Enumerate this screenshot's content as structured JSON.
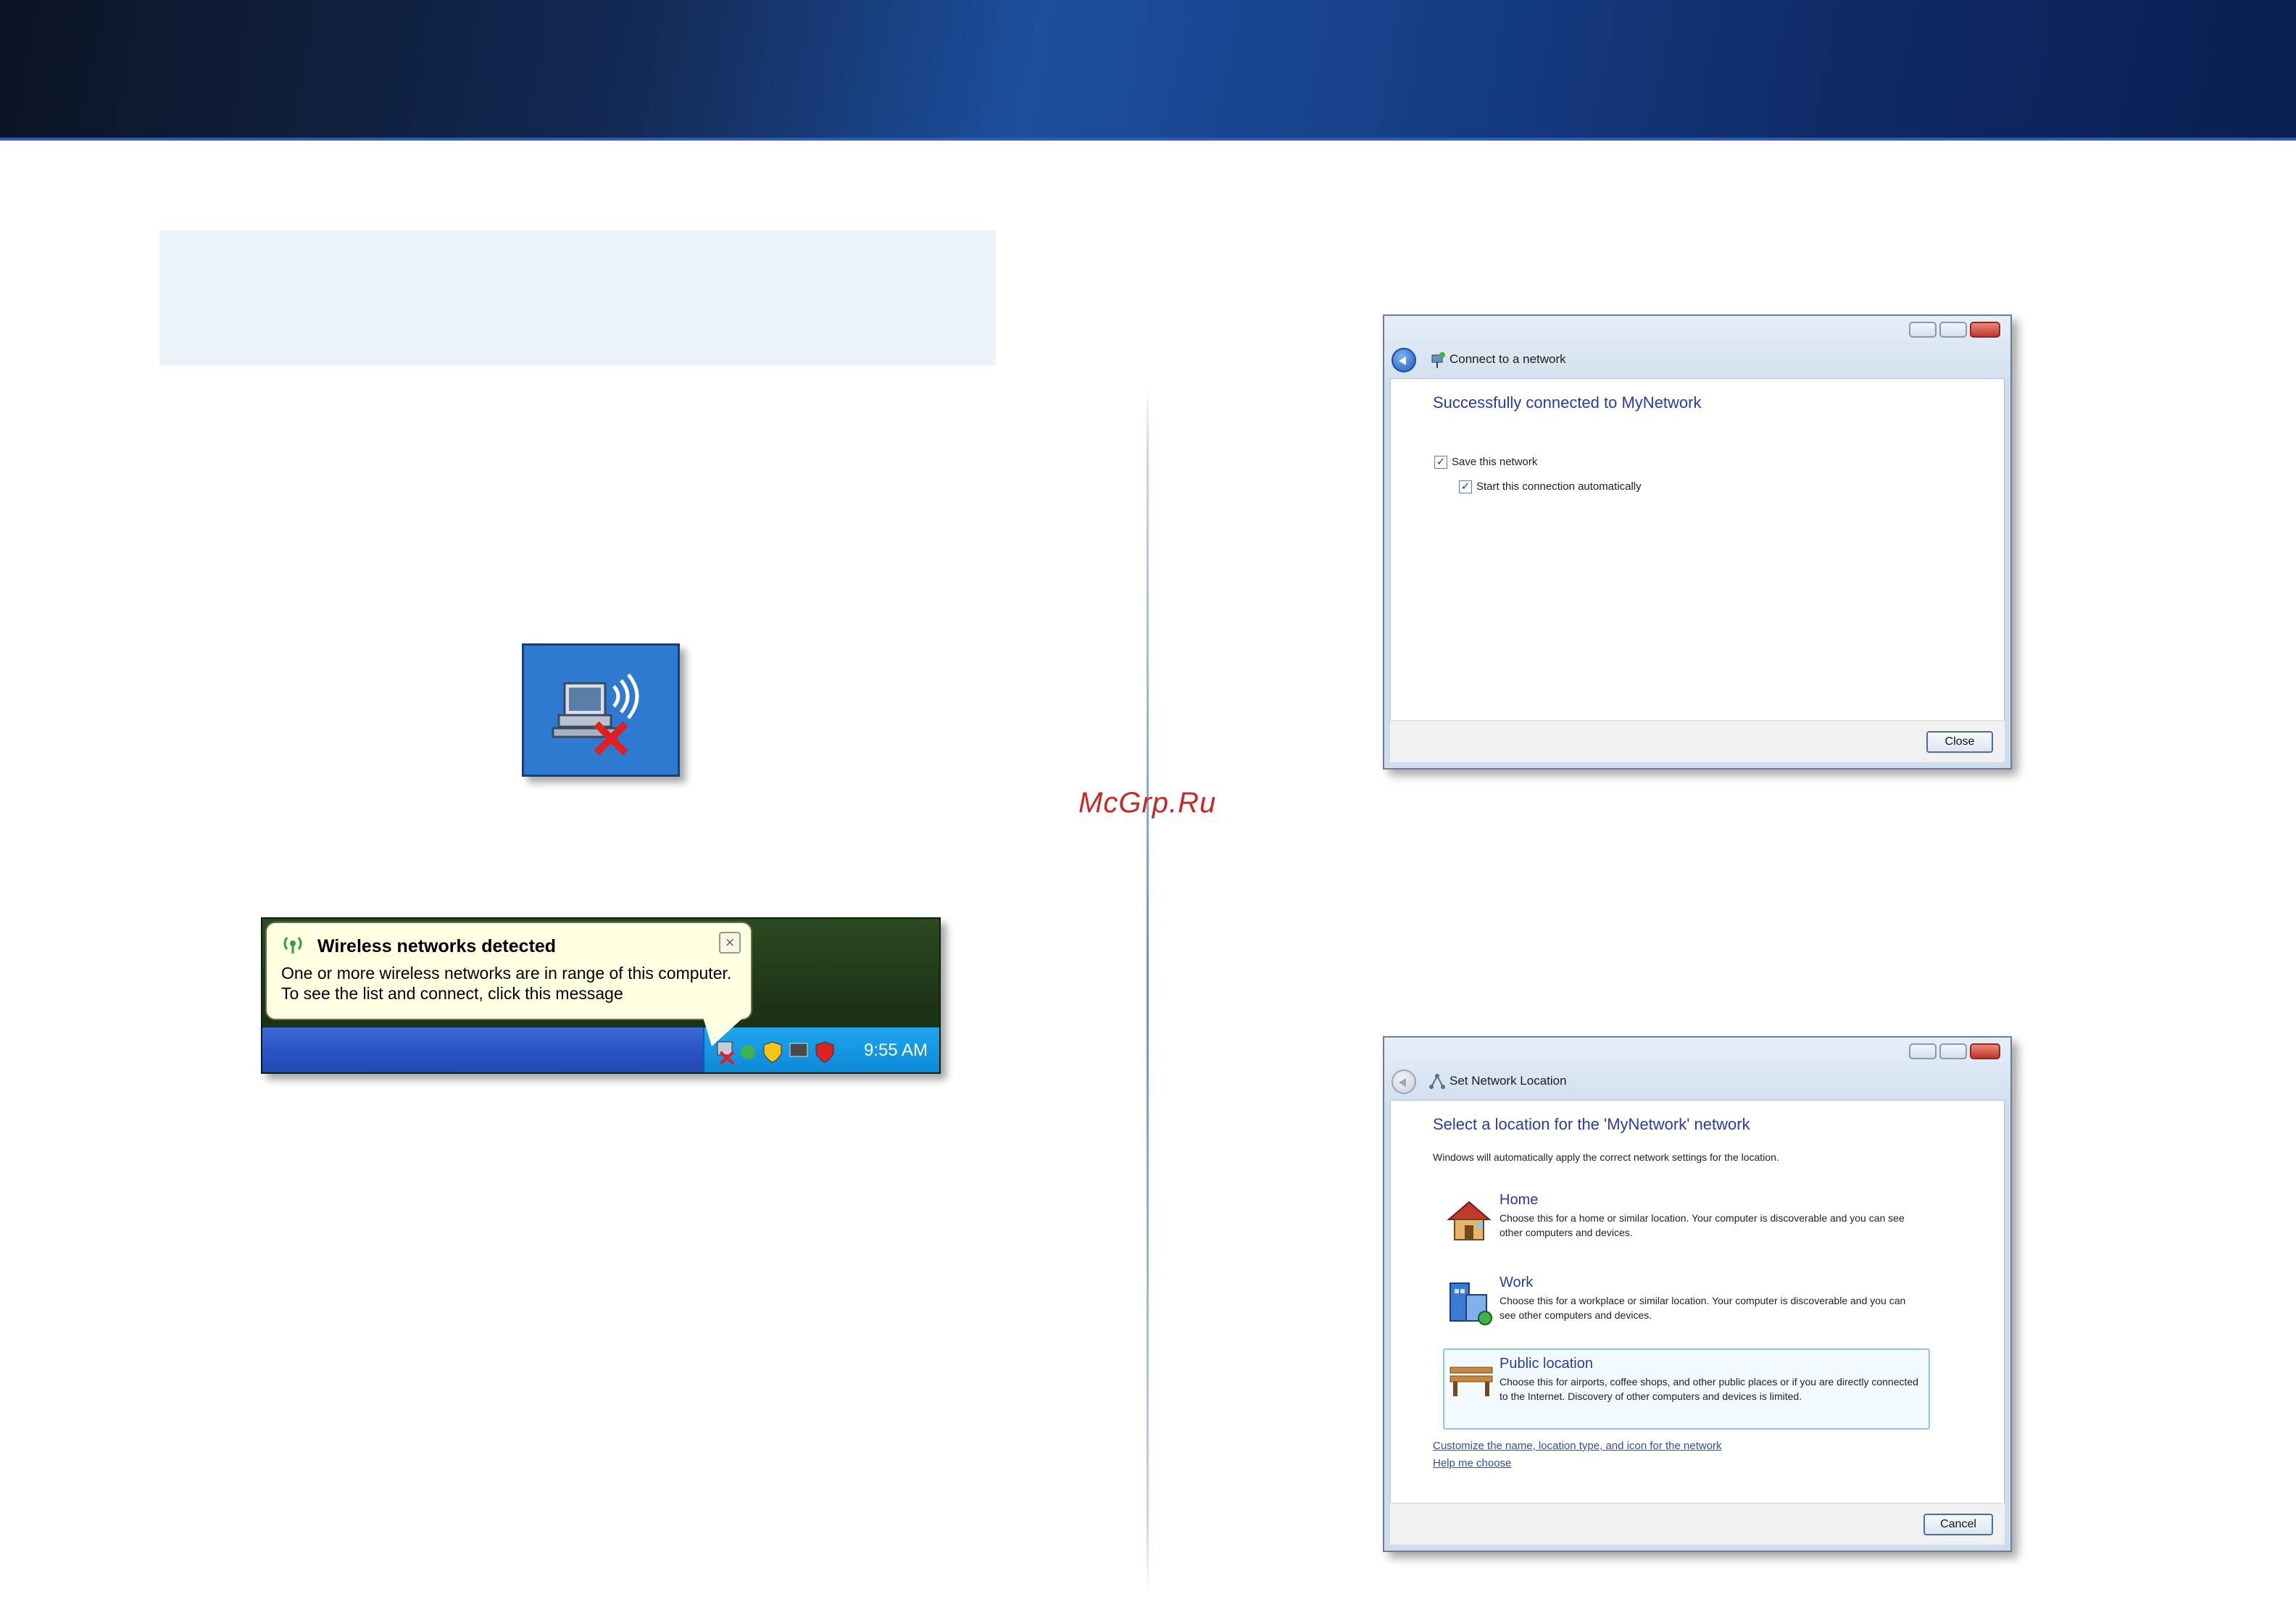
{
  "watermark": "McGrp.Ru",
  "tray_balloon": {
    "title": "Wireless networks detected",
    "line1": "One or more wireless networks are in range of this computer.",
    "line2": "To see the list and connect, click this message",
    "close_glyph": "×",
    "time": "9:55 AM"
  },
  "connect_window": {
    "title": "Connect to a network",
    "heading": "Successfully connected to MyNetwork",
    "save_network_label": "Save this network",
    "start_auto_label": "Start this connection automatically",
    "check_glyph": "✓",
    "close_button": "Close"
  },
  "location_window": {
    "title": "Set Network Location",
    "heading": "Select a location for the 'MyNetwork' network",
    "intro": "Windows will automatically apply the correct network settings for the location.",
    "options": [
      {
        "name": "Home",
        "description": "Choose this for a home or similar location. Your computer is discoverable and you can see other computers and devices."
      },
      {
        "name": "Work",
        "description": "Choose this for a workplace or similar location. Your computer is discoverable and you can see other computers and devices."
      },
      {
        "name": "Public location",
        "description": "Choose this for airports, coffee shops, and other public places or if you are directly connected to the Internet. Discovery of other computers and devices is limited."
      }
    ],
    "customize_link": "Customize the name, location type, and icon for the network",
    "help_link": "Help me choose",
    "cancel_button": "Cancel"
  }
}
